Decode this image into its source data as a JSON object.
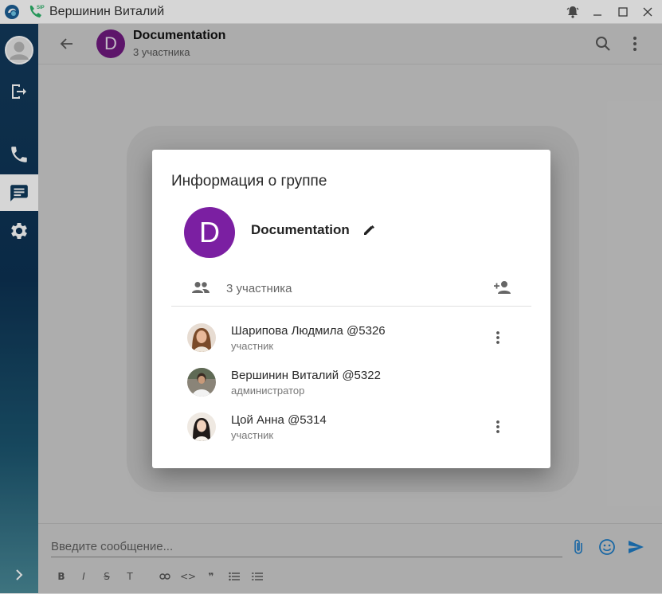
{
  "window": {
    "title": "Вершинин Виталий",
    "controls": [
      "bell-icon",
      "minimize-icon",
      "maximize-icon",
      "close-icon"
    ]
  },
  "sidebar": {
    "items": [
      {
        "name": "profile-avatar",
        "active": false
      },
      {
        "name": "logout",
        "icon": "logout-icon",
        "active": false
      },
      {
        "name": "calls",
        "icon": "phone-icon",
        "active": false
      },
      {
        "name": "chats",
        "icon": "chat-icon",
        "active": true
      },
      {
        "name": "settings",
        "icon": "gear-icon",
        "active": false
      },
      {
        "name": "expand",
        "icon": "chevron-right-icon",
        "active": false
      }
    ]
  },
  "chat_header": {
    "avatar_letter": "D",
    "title": "Documentation",
    "subtitle": "3 участника",
    "avatar_color": "#6f1a7f"
  },
  "composer": {
    "placeholder": "Введите сообщение...",
    "format_buttons": [
      {
        "name": "bold",
        "glyph": "B"
      },
      {
        "name": "italic",
        "glyph": "I"
      },
      {
        "name": "strikethrough",
        "glyph": "S"
      },
      {
        "name": "heading",
        "glyph": "T"
      },
      {
        "name": "link",
        "glyph": "🔗"
      },
      {
        "name": "code",
        "glyph": "<>"
      },
      {
        "name": "quote",
        "glyph": "❞"
      },
      {
        "name": "bulleted-list",
        "glyph": "≡"
      },
      {
        "name": "numbered-list",
        "glyph": "≡"
      }
    ],
    "accent": "#1e7bc4"
  },
  "dialog": {
    "title": "Информация о группе",
    "group_avatar_letter": "D",
    "group_name": "Documentation",
    "group_avatar_color": "#7b1fa2",
    "members_count": "3 участника",
    "members": [
      {
        "name": "Шарипова Людмила @5326",
        "role": "участник",
        "has_menu": true
      },
      {
        "name": "Вершинин Виталий @5322",
        "role": "администратор",
        "has_menu": false
      },
      {
        "name": "Цой Анна @5314",
        "role": "участник",
        "has_menu": true
      }
    ]
  }
}
